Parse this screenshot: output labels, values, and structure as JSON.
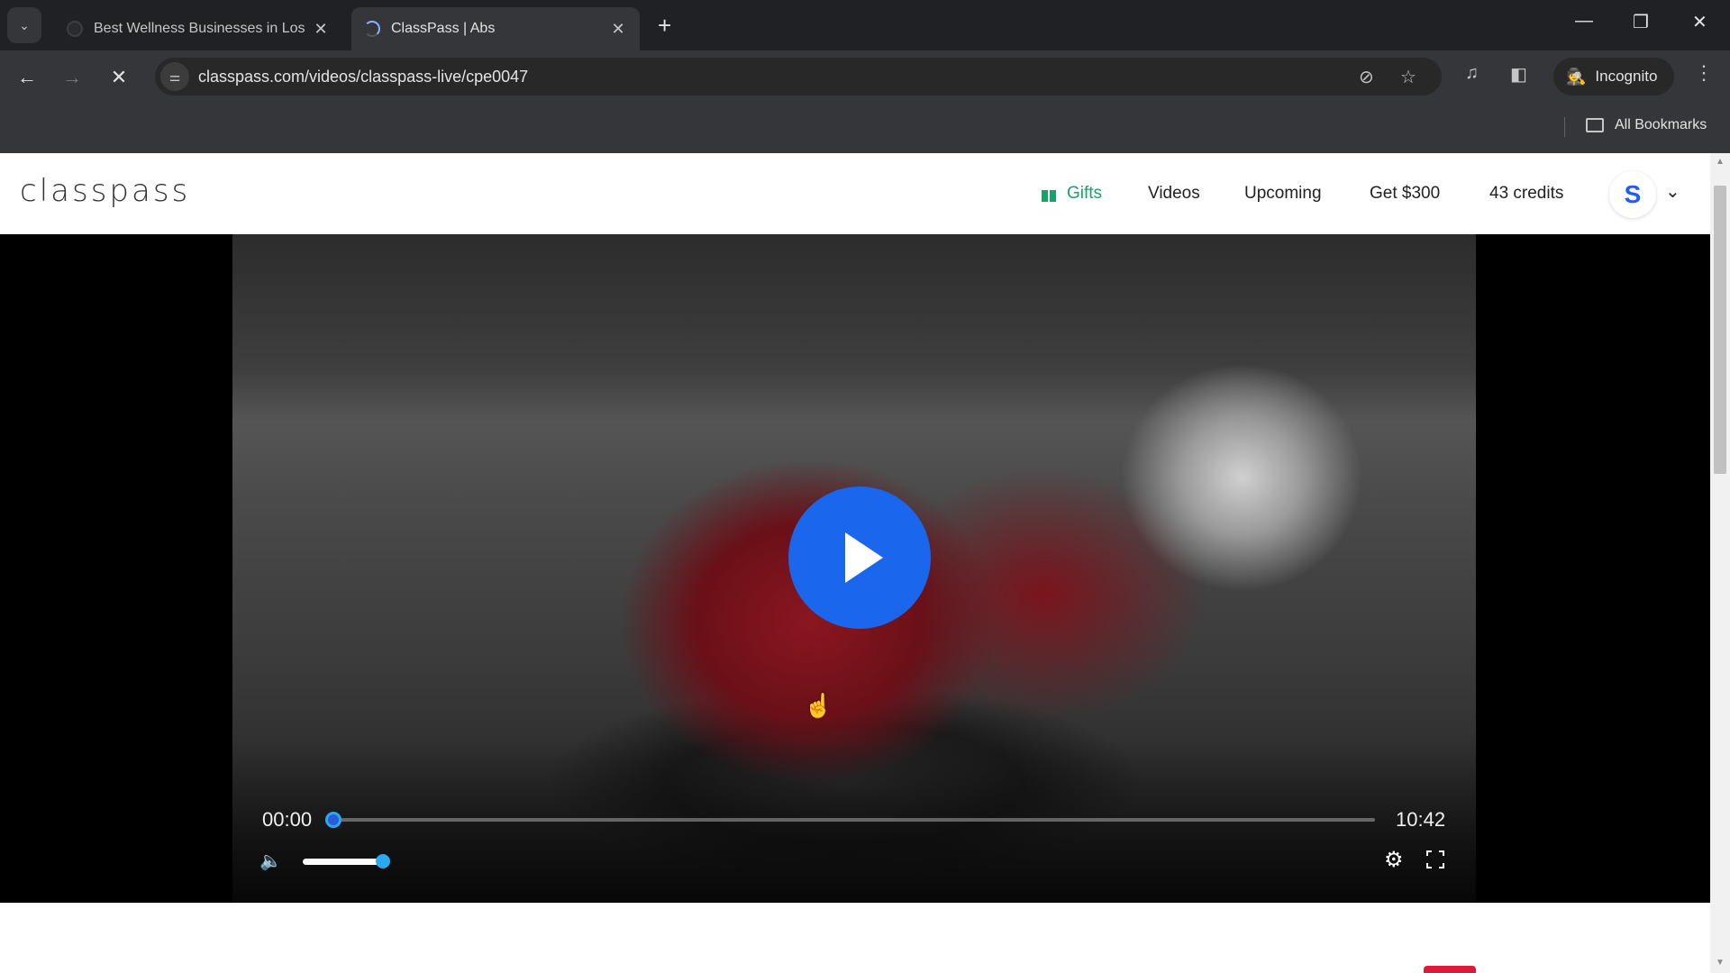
{
  "browser": {
    "tabs": [
      {
        "title": "Best Wellness Businesses in Los",
        "active": false
      },
      {
        "title": "ClassPass | Abs",
        "active": true
      }
    ],
    "url": "classpass.com/videos/classpass-live/cpe0047",
    "incognito_label": "Incognito",
    "bookmarks_label": "All Bookmarks",
    "icons": {
      "tab_search": "chevron-down-icon",
      "back": "arrow-left-icon",
      "forward": "arrow-right-icon",
      "stop": "close-icon",
      "site_info": "tune-icon",
      "eye_off": "eye-off-icon",
      "star": "star-icon",
      "media": "playlist-icon",
      "side_panel": "side-panel-icon",
      "incognito": "incognito-icon",
      "menu": "kebab-icon"
    },
    "glyphs": {
      "tab_close": "✕",
      "new_tab": "+",
      "minimize": "—",
      "restore": "❐",
      "window_close": "✕",
      "back": "←",
      "forward": "→",
      "stop": "✕",
      "tune": "⚌",
      "eye_off": "⊘",
      "star": "☆",
      "media": "♫",
      "side_panel": "◧",
      "incognito": "🕵",
      "kebab": "⋮",
      "tab_search": "⌄"
    }
  },
  "site": {
    "logo": "classpass",
    "nav": {
      "gifts": "Gifts",
      "videos": "Videos",
      "upcoming": "Upcoming",
      "referral": "Get $300",
      "credits": "43 credits"
    },
    "avatar_initial": "S",
    "chevron": "⌄",
    "colors": {
      "gifts": "#16a36b",
      "avatar": "#1e5ef6",
      "play_button": "#1a66ec",
      "seek_thumb": "#2aa8f0"
    }
  },
  "player": {
    "current_time": "00:00",
    "duration": "10:42",
    "progress_fraction": 0.0,
    "volume_fraction": 0.9,
    "glyphs": {
      "volume": "🔈",
      "settings": "⚙",
      "cursor": "☝"
    }
  },
  "scrollbar": {
    "up": "▲",
    "down": "▼"
  }
}
